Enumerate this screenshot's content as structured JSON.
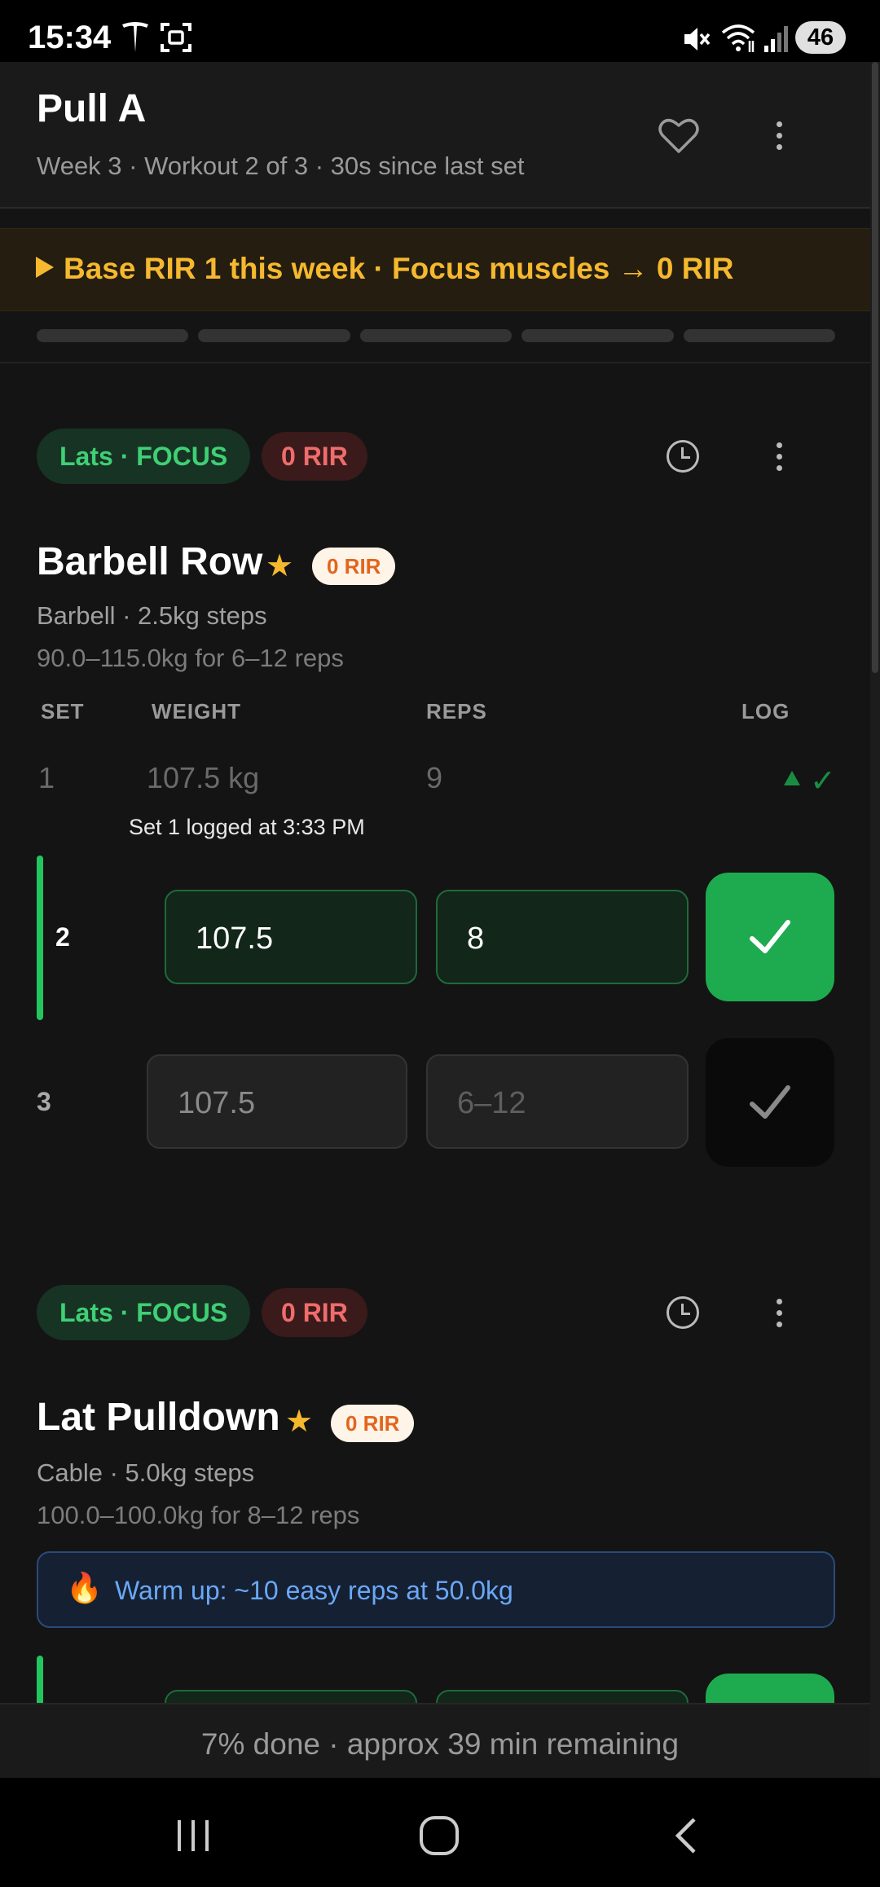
{
  "status_bar": {
    "time": "15:34",
    "battery": "46"
  },
  "header": {
    "title": "Pull A",
    "subtitle": "Week 3 · Workout 2 of 3 · 30s since last set"
  },
  "banner": {
    "text": "Base RIR 1 this week · Focus muscles → 0 RIR"
  },
  "progress_segments": 5,
  "exercises": [
    {
      "muscle_pill": "Lats · FOCUS",
      "rir_pill": "0 RIR",
      "name": "Barbell Row",
      "rir_badge": "0 RIR",
      "meta": "Barbell · 2.5kg steps",
      "range": "90.0–115.0kg for 6–12 reps",
      "columns": {
        "set": "SET",
        "weight": "WEIGHT",
        "reps": "REPS",
        "log": "LOG"
      },
      "sets": [
        {
          "num": "1",
          "weight": "107.5 kg",
          "reps": "9",
          "status": "logged",
          "note": "Set 1 logged at 3:33 PM"
        },
        {
          "num": "2",
          "weight": "107.5",
          "reps": "8",
          "status": "active"
        },
        {
          "num": "3",
          "weight": "107.5",
          "reps_placeholder": "6–12",
          "status": "pending"
        }
      ]
    },
    {
      "muscle_pill": "Lats · FOCUS",
      "rir_pill": "0 RIR",
      "name": "Lat Pulldown",
      "rir_badge": "0 RIR",
      "meta": "Cable · 5.0kg steps",
      "range": "100.0–100.0kg for 8–12 reps",
      "warmup": "Warm up: ~10 easy reps at 50.0kg"
    }
  ],
  "footer": {
    "text": "7% done · approx 39 min remaining"
  },
  "colors": {
    "accent": "#22c55e",
    "banner": "#f5b82e",
    "rir": "#f06c6c",
    "info": "#6aa8f5"
  },
  "icons": [
    "tesla-icon",
    "screenshot-icon",
    "mute-icon",
    "wifi-icon",
    "signal-icon",
    "heart-icon",
    "more-icon",
    "clock-icon",
    "star-icon",
    "check-icon",
    "fire-icon",
    "recents-icon",
    "home-icon",
    "back-icon"
  ]
}
